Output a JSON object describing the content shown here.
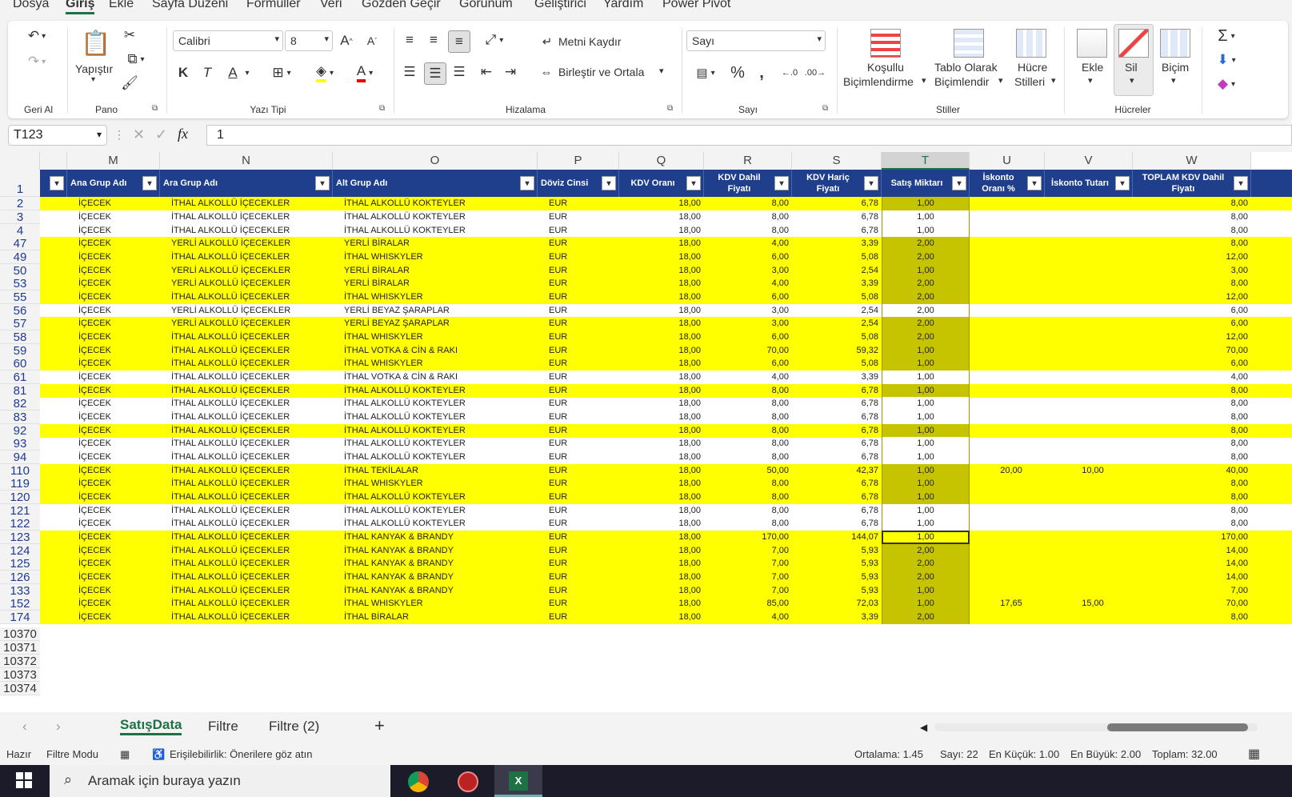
{
  "menu": [
    "Dosya",
    "Giriş",
    "Ekle",
    "Sayfa Düzeni",
    "Formüller",
    "Veri",
    "Gözden Geçir",
    "Görünüm",
    "Geliştirici",
    "Yardım",
    "Power Pivot"
  ],
  "ribbon": {
    "geri_al": "Geri Al",
    "pano": "Pano",
    "yapistir": "Yapıştır",
    "yazi_tipi": "Yazı Tipi",
    "font_name": "Calibri",
    "font_size": "8",
    "bold": "K",
    "italic": "T",
    "underline": "A",
    "hizalama": "Hizalama",
    "metni_kaydir": "Metni Kaydır",
    "birlestir": "Birleştir ve Ortala",
    "sayi": "Sayı",
    "sayi_format": "Sayı",
    "kosullu_1": "Koşullu",
    "kosullu_2": "Biçimlendirme",
    "tablo_1": "Tablo Olarak",
    "tablo_2": "Biçimlendir",
    "hucre_1": "Hücre",
    "hucre_2": "Stilleri",
    "stiller": "Stiller",
    "ekle": "Ekle",
    "sil": "Sil",
    "bicim": "Biçim",
    "hucreler": "Hücreler"
  },
  "formula_bar": {
    "name_box": "T123",
    "fx": "fx",
    "value": "1"
  },
  "columns": [
    "M",
    "N",
    "O",
    "P",
    "Q",
    "R",
    "S",
    "T",
    "U",
    "V",
    "W"
  ],
  "table_header": [
    "Ana Grup Adı",
    "Ara Grup Adı",
    "Alt Grup Adı",
    "Döviz Cinsi",
    "KDV Oranı",
    "KDV Dahil Fiyatı",
    "KDV Hariç Fiyatı",
    "Satış Miktarı",
    "İskonto Oranı %",
    "İskonto Tutarı",
    "TOPLAM KDV Dahil Fiyatı"
  ],
  "header_row_num": "1",
  "rows": [
    {
      "n": "2",
      "y": true,
      "c": [
        "İÇECEK",
        "İTHAL ALKOLLÜ İÇECEKLER",
        "İTHAL ALKOLLÜ KOKTEYLER",
        "EUR",
        "18,00",
        "8,00",
        "6,78",
        "1,00",
        "",
        "",
        "8,00"
      ]
    },
    {
      "n": "3",
      "y": false,
      "c": [
        "İÇECEK",
        "İTHAL ALKOLLÜ İÇECEKLER",
        "İTHAL ALKOLLÜ KOKTEYLER",
        "EUR",
        "18,00",
        "8,00",
        "6,78",
        "1,00",
        "",
        "",
        "8,00"
      ]
    },
    {
      "n": "4",
      "y": false,
      "c": [
        "İÇECEK",
        "İTHAL ALKOLLÜ İÇECEKLER",
        "İTHAL ALKOLLÜ KOKTEYLER",
        "EUR",
        "18,00",
        "8,00",
        "6,78",
        "1,00",
        "",
        "",
        "8,00"
      ]
    },
    {
      "n": "47",
      "y": true,
      "c": [
        "İÇECEK",
        "YERLİ ALKOLLÜ İÇECEKLER",
        "YERLİ BİRALAR",
        "EUR",
        "18,00",
        "4,00",
        "3,39",
        "2,00",
        "",
        "",
        "8,00"
      ]
    },
    {
      "n": "49",
      "y": true,
      "c": [
        "İÇECEK",
        "İTHAL ALKOLLÜ İÇECEKLER",
        "İTHAL WHISKYLER",
        "EUR",
        "18,00",
        "6,00",
        "5,08",
        "2,00",
        "",
        "",
        "12,00"
      ]
    },
    {
      "n": "50",
      "y": true,
      "c": [
        "İÇECEK",
        "YERLİ ALKOLLÜ İÇECEKLER",
        "YERLİ BİRALAR",
        "EUR",
        "18,00",
        "3,00",
        "2,54",
        "1,00",
        "",
        "",
        "3,00"
      ]
    },
    {
      "n": "53",
      "y": true,
      "c": [
        "İÇECEK",
        "YERLİ ALKOLLÜ İÇECEKLER",
        "YERLİ BİRALAR",
        "EUR",
        "18,00",
        "4,00",
        "3,39",
        "2,00",
        "",
        "",
        "8,00"
      ]
    },
    {
      "n": "55",
      "y": true,
      "c": [
        "İÇECEK",
        "İTHAL ALKOLLÜ İÇECEKLER",
        "İTHAL WHISKYLER",
        "EUR",
        "18,00",
        "6,00",
        "5,08",
        "2,00",
        "",
        "",
        "12,00"
      ]
    },
    {
      "n": "56",
      "y": false,
      "c": [
        "İÇECEK",
        "YERLİ ALKOLLÜ İÇECEKLER",
        "YERLİ BEYAZ ŞARAPLAR",
        "EUR",
        "18,00",
        "3,00",
        "2,54",
        "2,00",
        "",
        "",
        "6,00"
      ]
    },
    {
      "n": "57",
      "y": true,
      "c": [
        "İÇECEK",
        "YERLİ ALKOLLÜ İÇECEKLER",
        "YERLİ BEYAZ ŞARAPLAR",
        "EUR",
        "18,00",
        "3,00",
        "2,54",
        "2,00",
        "",
        "",
        "6,00"
      ]
    },
    {
      "n": "58",
      "y": true,
      "c": [
        "İÇECEK",
        "İTHAL ALKOLLÜ İÇECEKLER",
        "İTHAL WHISKYLER",
        "EUR",
        "18,00",
        "6,00",
        "5,08",
        "2,00",
        "",
        "",
        "12,00"
      ]
    },
    {
      "n": "59",
      "y": true,
      "c": [
        "İÇECEK",
        "İTHAL ALKOLLÜ İÇECEKLER",
        "İTHAL VOTKA & CİN & RAKI",
        "EUR",
        "18,00",
        "70,00",
        "59,32",
        "1,00",
        "",
        "",
        "70,00"
      ]
    },
    {
      "n": "60",
      "y": true,
      "c": [
        "İÇECEK",
        "İTHAL ALKOLLÜ İÇECEKLER",
        "İTHAL WHISKYLER",
        "EUR",
        "18,00",
        "6,00",
        "5,08",
        "1,00",
        "",
        "",
        "6,00"
      ]
    },
    {
      "n": "61",
      "y": false,
      "c": [
        "İÇECEK",
        "İTHAL ALKOLLÜ İÇECEKLER",
        "İTHAL VOTKA & CİN & RAKI",
        "EUR",
        "18,00",
        "4,00",
        "3,39",
        "1,00",
        "",
        "",
        "4,00"
      ]
    },
    {
      "n": "81",
      "y": true,
      "c": [
        "İÇECEK",
        "İTHAL ALKOLLÜ İÇECEKLER",
        "İTHAL ALKOLLÜ KOKTEYLER",
        "EUR",
        "18,00",
        "8,00",
        "6,78",
        "1,00",
        "",
        "",
        "8,00"
      ]
    },
    {
      "n": "82",
      "y": false,
      "c": [
        "İÇECEK",
        "İTHAL ALKOLLÜ İÇECEKLER",
        "İTHAL ALKOLLÜ KOKTEYLER",
        "EUR",
        "18,00",
        "8,00",
        "6,78",
        "1,00",
        "",
        "",
        "8,00"
      ]
    },
    {
      "n": "83",
      "y": false,
      "c": [
        "İÇECEK",
        "İTHAL ALKOLLÜ İÇECEKLER",
        "İTHAL ALKOLLÜ KOKTEYLER",
        "EUR",
        "18,00",
        "8,00",
        "6,78",
        "1,00",
        "",
        "",
        "8,00"
      ]
    },
    {
      "n": "92",
      "y": true,
      "c": [
        "İÇECEK",
        "İTHAL ALKOLLÜ İÇECEKLER",
        "İTHAL ALKOLLÜ KOKTEYLER",
        "EUR",
        "18,00",
        "8,00",
        "6,78",
        "1,00",
        "",
        "",
        "8,00"
      ]
    },
    {
      "n": "93",
      "y": false,
      "c": [
        "İÇECEK",
        "İTHAL ALKOLLÜ İÇECEKLER",
        "İTHAL ALKOLLÜ KOKTEYLER",
        "EUR",
        "18,00",
        "8,00",
        "6,78",
        "1,00",
        "",
        "",
        "8,00"
      ]
    },
    {
      "n": "94",
      "y": false,
      "c": [
        "İÇECEK",
        "İTHAL ALKOLLÜ İÇECEKLER",
        "İTHAL ALKOLLÜ KOKTEYLER",
        "EUR",
        "18,00",
        "8,00",
        "6,78",
        "1,00",
        "",
        "",
        "8,00"
      ]
    },
    {
      "n": "110",
      "y": true,
      "c": [
        "İÇECEK",
        "İTHAL ALKOLLÜ İÇECEKLER",
        "İTHAL TEKİLALAR",
        "EUR",
        "18,00",
        "50,00",
        "42,37",
        "1,00",
        "20,00",
        "10,00",
        "40,00"
      ]
    },
    {
      "n": "119",
      "y": true,
      "c": [
        "İÇECEK",
        "İTHAL ALKOLLÜ İÇECEKLER",
        "İTHAL WHISKYLER",
        "EUR",
        "18,00",
        "8,00",
        "6,78",
        "1,00",
        "",
        "",
        "8,00"
      ]
    },
    {
      "n": "120",
      "y": true,
      "c": [
        "İÇECEK",
        "İTHAL ALKOLLÜ İÇECEKLER",
        "İTHAL ALKOLLÜ KOKTEYLER",
        "EUR",
        "18,00",
        "8,00",
        "6,78",
        "1,00",
        "",
        "",
        "8,00"
      ]
    },
    {
      "n": "121",
      "y": false,
      "c": [
        "İÇECEK",
        "İTHAL ALKOLLÜ İÇECEKLER",
        "İTHAL ALKOLLÜ KOKTEYLER",
        "EUR",
        "18,00",
        "8,00",
        "6,78",
        "1,00",
        "",
        "",
        "8,00"
      ]
    },
    {
      "n": "122",
      "y": false,
      "c": [
        "İÇECEK",
        "İTHAL ALKOLLÜ İÇECEKLER",
        "İTHAL ALKOLLÜ KOKTEYLER",
        "EUR",
        "18,00",
        "8,00",
        "6,78",
        "1,00",
        "",
        "",
        "8,00"
      ]
    },
    {
      "n": "123",
      "y": true,
      "active": true,
      "c": [
        "İÇECEK",
        "İTHAL ALKOLLÜ İÇECEKLER",
        "İTHAL KANYAK & BRANDY",
        "EUR",
        "18,00",
        "170,00",
        "144,07",
        "1,00",
        "",
        "",
        "170,00"
      ]
    },
    {
      "n": "124",
      "y": true,
      "c": [
        "İÇECEK",
        "İTHAL ALKOLLÜ İÇECEKLER",
        "İTHAL KANYAK & BRANDY",
        "EUR",
        "18,00",
        "7,00",
        "5,93",
        "2,00",
        "",
        "",
        "14,00"
      ]
    },
    {
      "n": "125",
      "y": true,
      "c": [
        "İÇECEK",
        "İTHAL ALKOLLÜ İÇECEKLER",
        "İTHAL KANYAK & BRANDY",
        "EUR",
        "18,00",
        "7,00",
        "5,93",
        "2,00",
        "",
        "",
        "14,00"
      ]
    },
    {
      "n": "126",
      "y": true,
      "c": [
        "İÇECEK",
        "İTHAL ALKOLLÜ İÇECEKLER",
        "İTHAL KANYAK & BRANDY",
        "EUR",
        "18,00",
        "7,00",
        "5,93",
        "2,00",
        "",
        "",
        "14,00"
      ]
    },
    {
      "n": "133",
      "y": true,
      "c": [
        "İÇECEK",
        "İTHAL ALKOLLÜ İÇECEKLER",
        "İTHAL KANYAK & BRANDY",
        "EUR",
        "18,00",
        "7,00",
        "5,93",
        "1,00",
        "",
        "",
        "7,00"
      ]
    },
    {
      "n": "152",
      "y": true,
      "c": [
        "İÇECEK",
        "İTHAL ALKOLLÜ İÇECEKLER",
        "İTHAL WHISKYLER",
        "EUR",
        "18,00",
        "85,00",
        "72,03",
        "1,00",
        "17,65",
        "15,00",
        "70,00"
      ]
    },
    {
      "n": "174",
      "y": true,
      "c": [
        "İÇECEK",
        "İTHAL ALKOLLÜ İÇECEKLER",
        "İTHAL BİRALAR",
        "EUR",
        "18,00",
        "4,00",
        "3,39",
        "2,00",
        "",
        "",
        "8,00"
      ]
    }
  ],
  "empty_rows": [
    "10370",
    "10371",
    "10372",
    "10373",
    "10374"
  ],
  "sheet_tabs": [
    "SatışData",
    "Filtre",
    "Filtre (2)"
  ],
  "add_sheet": "+",
  "status_bar": {
    "ready": "Hazır",
    "filter_mode": "Filtre Modu",
    "accessibility": "Erişilebilirlik: Önerilere göz atın",
    "average": "Ortalama: 1.45",
    "count": "Sayı: 22",
    "min": "En Küçük: 1.00",
    "max": "En Büyük: 2.00",
    "sum": "Toplam: 32.00"
  },
  "taskbar": {
    "search_placeholder": "Aramak için buraya yazın"
  },
  "colors": {
    "yellow": "#ffff00",
    "header_blue": "#1f3f8c",
    "selected_olive": "#c6c400",
    "excel_green": "#1e7145"
  }
}
